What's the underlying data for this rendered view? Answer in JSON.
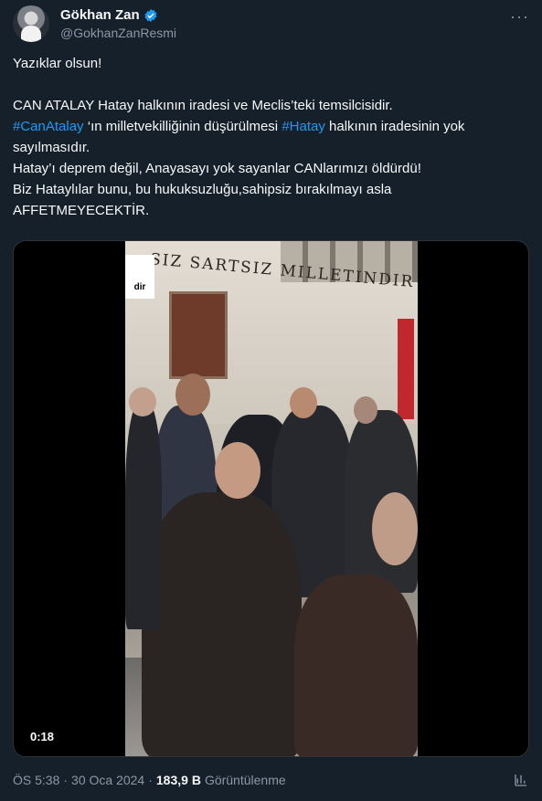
{
  "author": {
    "display_name": "Gökhan Zan",
    "handle": "@GokhanZanResmi"
  },
  "tweet": {
    "line1": "Yazıklar olsun!",
    "line2": "CAN ATALAY Hatay halkının iradesi ve Meclis’teki temsilcisidir.",
    "tag1": "#CanAtalay",
    "line3a": " ‘ın milletvekilliğinin düşürülmesi ",
    "tag2": "#Hatay",
    "line3b": " halkının iradesinin yok sayılmasıdır.",
    "line4": "Hatay’ı deprem değil, Anayasayı yok sayanlar CANlarımızı öldürdü!",
    "line5": "Biz Hataylılar bunu, bu hukuksuzluğu,sahipsiz bırakılmayı asla",
    "line6": "AFFETMEYECEKTİR."
  },
  "video": {
    "duration": "0:18",
    "inscription": "SIZ SARTSIZ MILLETINDIR",
    "placard_text": "dir"
  },
  "meta": {
    "time": "ÖS 5:38",
    "separator": "·",
    "date": "30 Oca 2024",
    "views_count": "183,9 B",
    "views_label": "Görüntülenme"
  },
  "icons": {
    "verified": "verified-badge-icon",
    "more": "more-options-icon",
    "analytics": "analytics-icon"
  },
  "colors": {
    "background": "#15202b",
    "link": "#1d9bf0",
    "secondary_text": "#8b98a5"
  }
}
